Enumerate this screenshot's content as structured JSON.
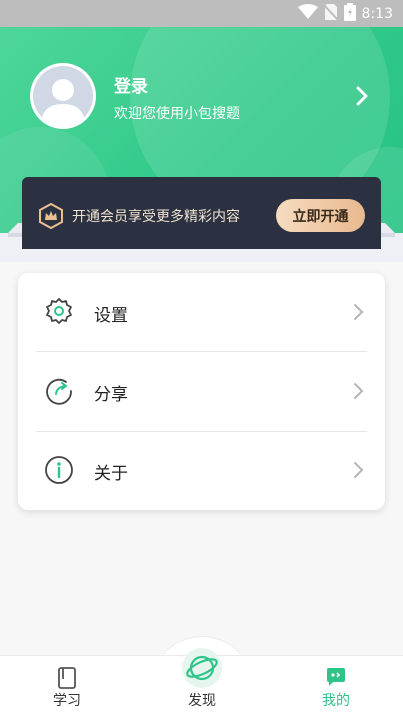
{
  "status_bar": {
    "time": "8:13"
  },
  "profile": {
    "title": "登录",
    "subtitle": "欢迎您使用小包搜题"
  },
  "vip": {
    "text": "开通会员享受更多精彩内容",
    "button_label": "立即开通"
  },
  "menu": {
    "items": [
      {
        "label": "设置",
        "icon": "gear-icon"
      },
      {
        "label": "分享",
        "icon": "share-icon"
      },
      {
        "label": "关于",
        "icon": "info-icon"
      }
    ]
  },
  "bottom_nav": {
    "items": [
      {
        "label": "学习",
        "icon": "book-icon"
      },
      {
        "label": "发现",
        "icon": "planet-icon"
      },
      {
        "label": "我的",
        "icon": "chat-face-icon",
        "active": true
      }
    ]
  },
  "colors": {
    "brand_green": "#2ec489",
    "vip_card": "#2c3142",
    "vip_gold": "#e8b98f"
  }
}
